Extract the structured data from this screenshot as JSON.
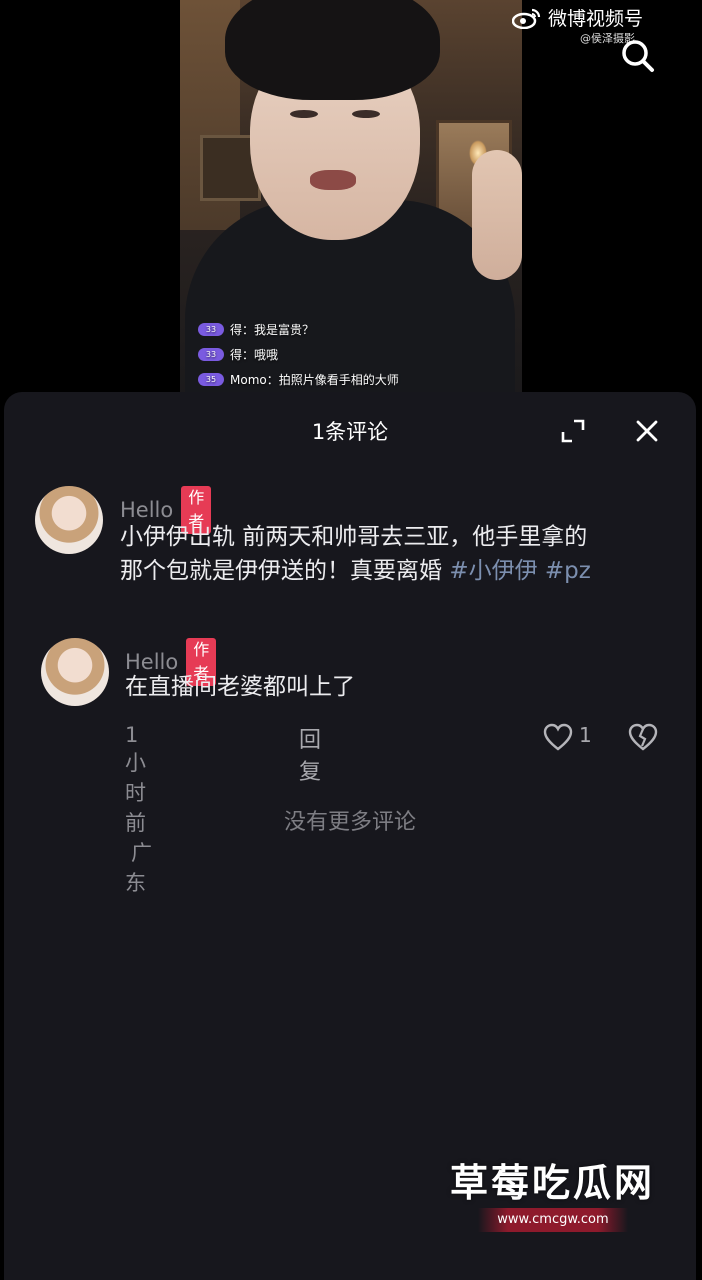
{
  "video": {
    "chat": [
      {
        "level": "33",
        "text": "得：我是富贵？"
      },
      {
        "level": "33",
        "text": "得：哦哦"
      },
      {
        "level": "35",
        "text": "Momo：拍照片像看手相的大师"
      }
    ]
  },
  "watermark": {
    "brand": "微博视频号",
    "handle": "@侯泽摄影"
  },
  "panel": {
    "title": "1条评论",
    "comments": [
      {
        "username": "Hello",
        "badge": "作者",
        "text_line1": "小伊伊出轨 前两天和帅哥去三亚，他手里拿的",
        "text_line2": "那个包就是伊伊送的！真要离婚",
        "hashtags": [
          "#小伊伊",
          "#pz"
        ]
      },
      {
        "username": "Hello",
        "badge": "作者",
        "text": "在直播间老婆都叫上了",
        "time": "1小时前",
        "location": "广东",
        "reply_label": "回复",
        "like_count": "1"
      }
    ],
    "no_more": "没有更多评论"
  },
  "site": {
    "title": "草莓吃瓜网",
    "url": "www.cmcgw.com"
  }
}
